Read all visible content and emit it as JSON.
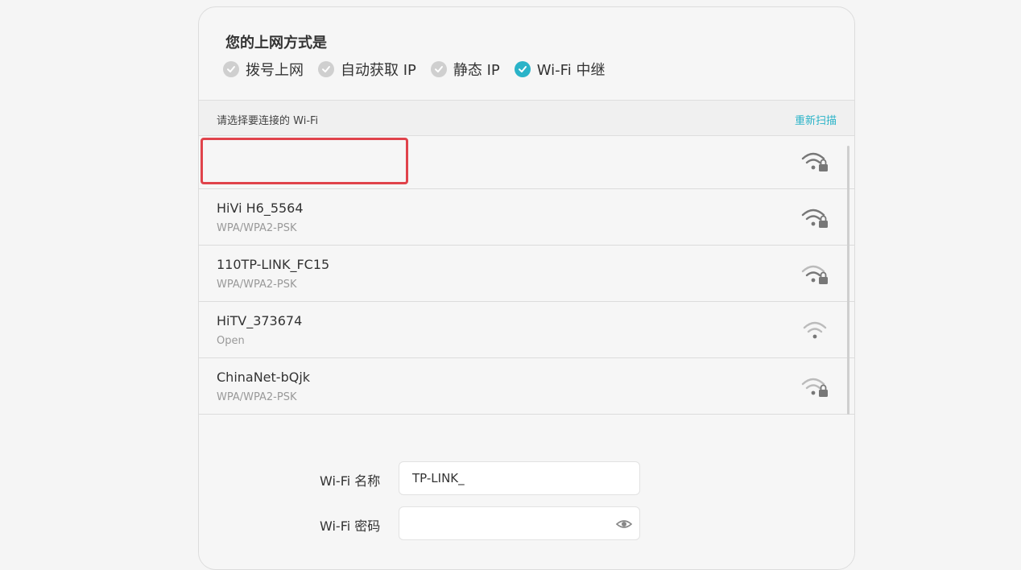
{
  "panel": {
    "heading": "您的上网方式是",
    "modes": [
      {
        "label": "拨号上网",
        "selected": false
      },
      {
        "label": "自动获取 IP",
        "selected": false
      },
      {
        "label": "静态 IP",
        "selected": false
      },
      {
        "label": "Wi-Fi 中继",
        "selected": true
      }
    ]
  },
  "wifi_list": {
    "hint": "请选择要连接的 Wi-Fi",
    "rescan": "重新扫描",
    "networks": [
      {
        "name": "",
        "security": "",
        "locked": true
      },
      {
        "name": "HiVi H6_5564",
        "security": "WPA/WPA2-PSK",
        "locked": true
      },
      {
        "name": "110TP-LINK_FC15",
        "security": "WPA/WPA2-PSK",
        "locked": true
      },
      {
        "name": "HiTV_373674",
        "security": "Open",
        "locked": false
      },
      {
        "name": "ChinaNet-bQjk",
        "security": "WPA/WPA2-PSK",
        "locked": true
      }
    ]
  },
  "form": {
    "name_label": "Wi-Fi 名称",
    "name_value": "TP-LINK_",
    "password_label": "Wi-Fi 密码"
  },
  "colors": {
    "accent": "#2ab3c8",
    "highlight": "#e0434b"
  },
  "icons": [
    "check-icon",
    "wifi-lock-icon",
    "wifi-icon",
    "eye-icon"
  ]
}
